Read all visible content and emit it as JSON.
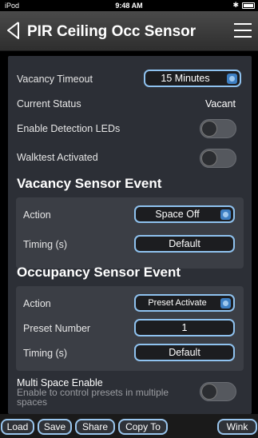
{
  "status_bar": {
    "carrier": "iPod",
    "time": "9:48 AM",
    "bluetooth": "✱"
  },
  "nav": {
    "title": "PIR Ceiling Occ Sensor",
    "back_icon": "back-chevron-icon",
    "menu_icon": "hamburger-menu-icon"
  },
  "settings": {
    "vacancy_timeout_label": "Vacancy Timeout",
    "vacancy_timeout_value": "15 Minutes",
    "current_status_label": "Current Status",
    "current_status_value": "Vacant",
    "enable_leds_label": "Enable Detection LEDs",
    "enable_leds_on": false,
    "walktest_label": "Walktest Activated",
    "walktest_on": false
  },
  "vacancy_event": {
    "title": "Vacancy Sensor Event",
    "action_label": "Action",
    "action_value": "Space Off",
    "timing_label": "Timing (s)",
    "timing_value": "Default"
  },
  "occupancy_event": {
    "title": "Occupancy Sensor Event",
    "action_label": "Action",
    "action_value": "Preset Activate",
    "preset_label": "Preset Number",
    "preset_value": "1",
    "timing_label": "Timing (s)",
    "timing_value": "Default"
  },
  "multi_space": {
    "label": "Multi Space Enable",
    "description": "Enable to control presets in multiple spaces",
    "on": false
  },
  "bottom_bar": {
    "load": "Load",
    "save": "Save",
    "share": "Share",
    "copy_to": "Copy To",
    "wink": "Wink"
  },
  "colors": {
    "accent_border": "#8fc2ef",
    "panel": "#3b3e45",
    "background": "#2c2f36"
  }
}
